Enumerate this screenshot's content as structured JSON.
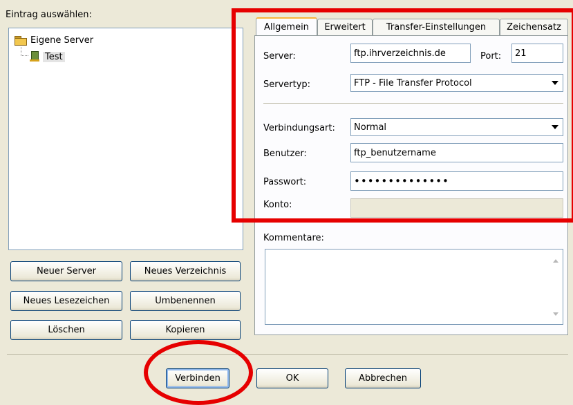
{
  "tree": {
    "title": "Eintrag auswählen:",
    "root_label": "Eigene Server",
    "child_label": "Test"
  },
  "left_buttons": {
    "new_server": "Neuer Server",
    "new_folder": "Neues Verzeichnis",
    "new_bookmark": "Neues Lesezeichen",
    "rename": "Umbenennen",
    "delete": "Löschen",
    "copy": "Kopieren"
  },
  "tabs": [
    {
      "label": "Allgemein",
      "active": true
    },
    {
      "label": "Erweitert",
      "active": false
    },
    {
      "label": "Transfer-Einstellungen",
      "active": false
    },
    {
      "label": "Zeichensatz",
      "active": false
    }
  ],
  "form": {
    "server_label": "Server:",
    "server_value": "ftp.ihrverzeichnis.de",
    "port_label": "Port:",
    "port_value": "21",
    "servertype_label": "Servertyp:",
    "servertype_value": "FTP - File Transfer Protocol",
    "connection_label": "Verbindungsart:",
    "connection_value": "Normal",
    "user_label": "Benutzer:",
    "user_value": "ftp_benutzername",
    "password_label": "Passwort:",
    "password_value": "••••••••••••••",
    "account_label": "Konto:",
    "account_value": "",
    "comments_label": "Kommentare:",
    "comments_value": ""
  },
  "footer": {
    "connect": "Verbinden",
    "ok": "OK",
    "cancel": "Abbrechen"
  },
  "annotations": {
    "highlight_color": "#e60000"
  }
}
